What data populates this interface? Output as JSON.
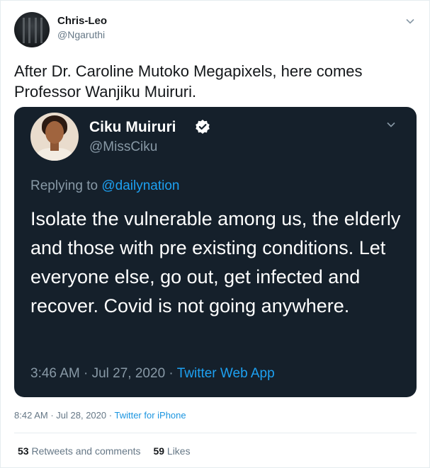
{
  "author": {
    "name": "Chris-Leo",
    "handle": "@Ngaruthi"
  },
  "tweet": {
    "text": "After Dr. Caroline Mutoko Megapixels, here comes Professor Wanjiku Muiruri."
  },
  "quoted": {
    "name": "Ciku Muiruri",
    "handle": "@MissCiku",
    "replying_prefix": "Replying to ",
    "replying_to": "@dailynation",
    "text": "Isolate the vulnerable among us, the elderly and those with pre existing conditions. Let everyone else, go out, get infected and recover. Covid is not going anywhere.",
    "time": "3:46 AM",
    "date": "Jul 27, 2020",
    "source": "Twitter Web App"
  },
  "meta": {
    "time": "8:42 AM",
    "date": "Jul 28, 2020",
    "source": "Twitter for iPhone"
  },
  "stats": {
    "retweets_count": "53",
    "retweets_label": "Retweets and comments",
    "likes_count": "59",
    "likes_label": "Likes"
  },
  "colors": {
    "link": "#1da1f2",
    "quote_bg": "#15202b",
    "muted": "#657786"
  },
  "icons": {
    "caret": "chevron-down-icon",
    "verified": "verified-badge-icon"
  }
}
